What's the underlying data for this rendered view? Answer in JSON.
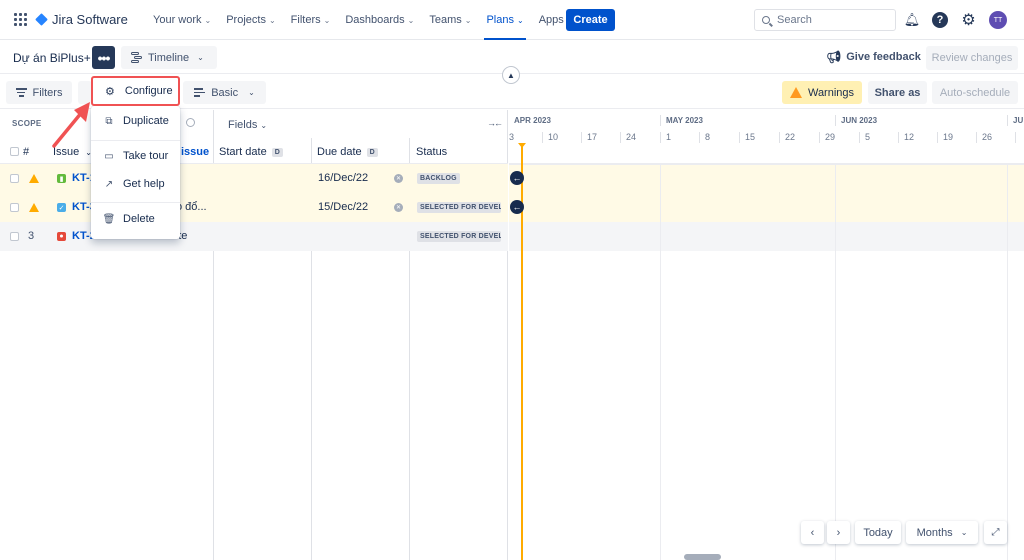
{
  "topnav": {
    "product": "Jira Software",
    "items": [
      {
        "label": "Your work",
        "active": false
      },
      {
        "label": "Projects",
        "active": false
      },
      {
        "label": "Filters",
        "active": false
      },
      {
        "label": "Dashboards",
        "active": false
      },
      {
        "label": "Teams",
        "active": false
      },
      {
        "label": "Plans",
        "active": true
      },
      {
        "label": "Apps",
        "active": false
      }
    ],
    "create_label": "Create",
    "search_placeholder": "Search",
    "avatar_initials": "TT",
    "brand_color": "#0052cc",
    "avatar_color": "#5e4db2"
  },
  "planbar": {
    "project_name": "Dự án BiPlus+",
    "more_label": "•••",
    "view_label": "Timeline",
    "feedback_label": "Give feedback",
    "review_label": "Review changes"
  },
  "toolbar": {
    "filters_label": "Filters",
    "basic_label": "Basic",
    "warnings_label": "Warnings",
    "share_label": "Share as",
    "autoschedule_label": "Auto-schedule"
  },
  "menu": {
    "configure_label": "Configure",
    "items": [
      {
        "label": "Duplicate",
        "icon": "duplicate-icon"
      },
      {
        "label": "Take tour",
        "icon": "presentation-icon"
      },
      {
        "label": "Get help",
        "icon": "external-link-icon"
      },
      {
        "label": "Delete",
        "icon": "trash-icon"
      }
    ]
  },
  "table": {
    "scope_label": "SCOPE",
    "fields_label": "Fields",
    "headers": {
      "num": "#",
      "issue": "Issue",
      "create_issue": "issue",
      "start_date": "Start date",
      "due_date": "Due date",
      "status": "Status",
      "date_badge": "D"
    },
    "rows": [
      {
        "num": "",
        "warning": true,
        "type": "story",
        "type_color": "#63ba3c",
        "key": "KT-1",
        "summary": "",
        "start": "",
        "due": "16/Dec/22",
        "status": "BACKLOG"
      },
      {
        "num": "",
        "warning": true,
        "type": "task",
        "type_color": "#4bade8",
        "key": "KT-3",
        "summary": "o đổ...",
        "start": "",
        "due": "15/Dec/22",
        "status": "SELECTED FOR DEVELOPMENT"
      },
      {
        "num": "3",
        "warning": false,
        "type": "bug",
        "type_color": "#e5493a",
        "key": "KT-2",
        "summary": "...bsite",
        "start": "",
        "due": "",
        "status": "SELECTED FOR DEVELOPMENT"
      }
    ]
  },
  "timeline": {
    "months": [
      "APR 2023",
      "MAY 2023",
      "JUN 2023",
      "JU"
    ],
    "weeks": [
      "3",
      "10",
      "17",
      "24",
      "1",
      "8",
      "15",
      "22",
      "29",
      "5",
      "12",
      "19",
      "26",
      ""
    ],
    "today_color": "#ffab00"
  },
  "timeline_nav": {
    "prev": "‹",
    "next": "›",
    "today_label": "Today",
    "scale_label": "Months"
  }
}
